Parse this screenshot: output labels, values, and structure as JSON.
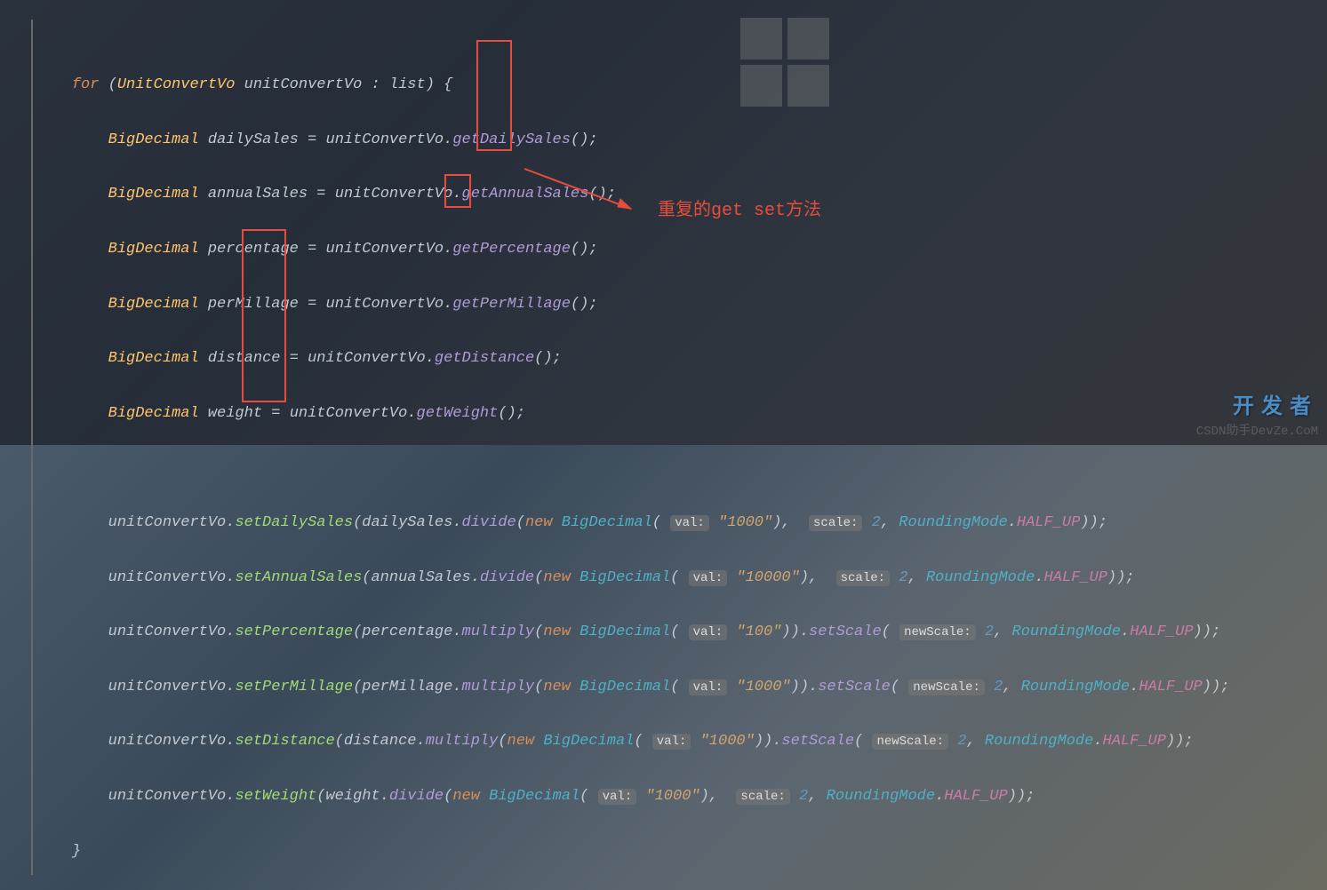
{
  "annotation": "重复的get set方法",
  "watermark_right": "开发者",
  "watermark_csdn": "CSDN助手DevZe.CoM",
  "code": {
    "l1": {
      "kw": "for",
      "type": "UnitConvertVo",
      "var": "unitConvertVo",
      "colon": ":",
      "list": "list",
      "brace": "{"
    },
    "l2": {
      "type": "BigDecimal",
      "var": "dailySales",
      "eq": "=",
      "obj": "unitConvertVo",
      "method": "getDailySales",
      "end": "();"
    },
    "l3": {
      "type": "BigDecimal",
      "var": "annualSales",
      "eq": "=",
      "obj": "unitConvertVo",
      "method": "getAnnualSales",
      "end": "();"
    },
    "l4": {
      "type": "BigDecimal",
      "var": "percentage",
      "eq": "=",
      "obj": "unitConvertVo",
      "method": "getPercentage",
      "end": "();"
    },
    "l5": {
      "type": "BigDecimal",
      "var": "perMillage",
      "eq": "=",
      "obj": "unitConvertVo",
      "method": "getPerMillage",
      "end": "();"
    },
    "l6": {
      "type": "BigDecimal",
      "var": "distance",
      "eq": "=",
      "obj": "unitConvertVo",
      "method": "getDistance",
      "end": "();"
    },
    "l7": {
      "type": "BigDecimal",
      "var": "weight",
      "eq": "=",
      "obj": "unitConvertVo",
      "method": "getWeight",
      "end": "();"
    },
    "l9": {
      "obj": "unitConvertVo",
      "method": "setDailySales",
      "arg": "dailySales",
      "op": "divide",
      "new": "new",
      "cls": "BigDecimal",
      "h1": "val:",
      "v1": "\"1000\"",
      "h2": "scale:",
      "v2": "2",
      "rm": "RoundingMode",
      "mode": "HALF_UP",
      "end": "));"
    },
    "l10": {
      "obj": "unitConvertVo",
      "method": "setAnnualSales",
      "arg": "annualSales",
      "op": "divide",
      "new": "new",
      "cls": "BigDecimal",
      "h1": "val:",
      "v1": "\"10000\"",
      "h2": "scale:",
      "v2": "2",
      "rm": "RoundingMode",
      "mode": "HALF_UP",
      "end": "));"
    },
    "l11": {
      "obj": "unitConvertVo",
      "method": "setPercentage",
      "arg": "percentage",
      "op": "multiply",
      "new": "new",
      "cls": "BigDecimal",
      "h1": "val:",
      "v1": "\"100\"",
      "ss": "setScale",
      "h2": "newScale:",
      "v2": "2",
      "rm": "RoundingMode",
      "mode": "HALF_UP",
      "end": "));"
    },
    "l12": {
      "obj": "unitConvertVo",
      "method": "setPerMillage",
      "arg": "perMillage",
      "op": "multiply",
      "new": "new",
      "cls": "BigDecimal",
      "h1": "val:",
      "v1": "\"1000\"",
      "ss": "setScale",
      "h2": "newScale:",
      "v2": "2",
      "rm": "RoundingMode",
      "mode": "HALF_UP",
      "end": "));"
    },
    "l13": {
      "obj": "unitConvertVo",
      "method": "setDistance",
      "arg": "distance",
      "op": "multiply",
      "new": "new",
      "cls": "BigDecimal",
      "h1": "val:",
      "v1": "\"1000\"",
      "ss": "setScale",
      "h2": "newScale:",
      "v2": "2",
      "rm": "RoundingMode",
      "mode": "HALF_UP",
      "end": "));"
    },
    "l14": {
      "obj": "unitConvertVo",
      "method": "setWeight",
      "arg": "weight",
      "op": "divide",
      "new": "new",
      "cls": "BigDecimal",
      "h1": "val:",
      "v1": "\"1000\"",
      "h2": "scale:",
      "v2": "2",
      "rm": "RoundingMode",
      "mode": "HALF_UP",
      "end": "));"
    },
    "l15": {
      "brace": "}"
    }
  }
}
